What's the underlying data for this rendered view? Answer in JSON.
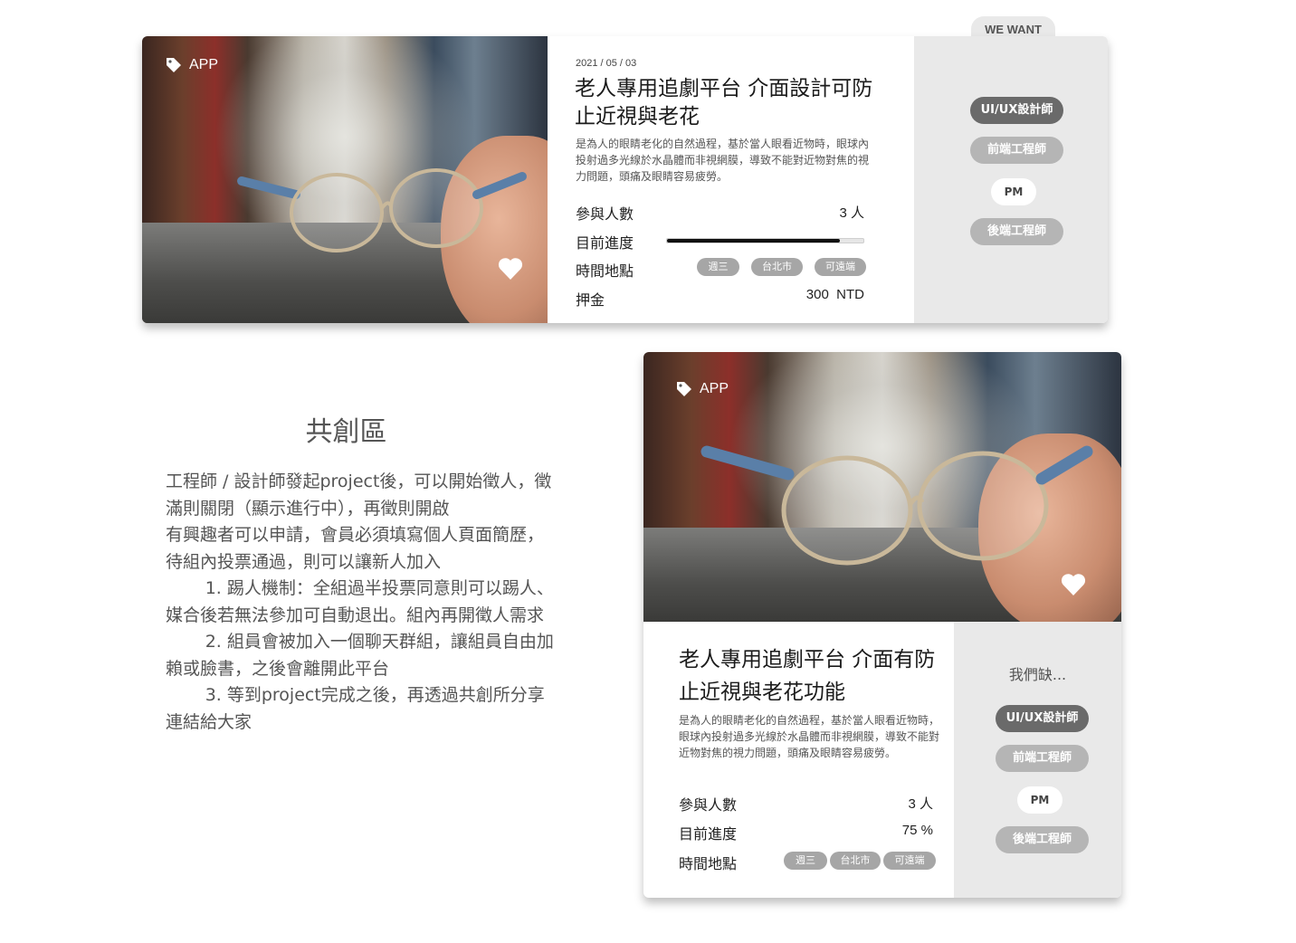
{
  "card1": {
    "tag": "APP",
    "date": "2021 / 05 / 03",
    "title": "老人專用追劇平台 介面設計可防止近視與老花",
    "desc": "是為人的眼睛老化的自然過程，基於當人眼看近物時，眼球內投射過多光線於水晶體而非視網膜，導致不能對近物對焦的視力問題，頭痛及眼睛容易疲勞。",
    "rows": {
      "participants_label": "參與人數",
      "participants_value": "3 人",
      "progress_label": "目前進度",
      "progress_fraction": 0.88,
      "time_label": "時間地點",
      "deposit_label": "押金",
      "deposit_value": "300  NTD"
    },
    "pills": [
      "週三",
      "台北市",
      "可遠端"
    ],
    "want_title": "WE WANT",
    "roles": [
      "UI/UX設計師",
      "前端工程師",
      "PM",
      "後端工程師"
    ]
  },
  "section": {
    "title": "共創區",
    "paragraphs": [
      "工程師 / 設計師發起project後，可以開始徵人，徵滿則關閉（顯示進行中），再徵則開啟",
      "有興趣者可以申請，會員必須填寫個人頁面簡歷，待組內投票通過，則可以讓新人加入",
      "1. 踢人機制：全組過半投票同意則可以踢人、媒合後若無法參加可自動退出。組內再開徵人需求",
      "2. 組員會被加入一個聊天群組，讓組員自由加賴或臉書，之後會離開此平台",
      "3. 等到project完成之後，再透過共創所分享連結給大家"
    ]
  },
  "card2": {
    "tag": "APP",
    "title": "老人專用追劇平台 介面有防止近視與老花功能",
    "desc": "是為人的眼睛老化的自然過程，基於當人眼看近物時，眼球內投射過多光線於水晶體而非視網膜，導致不能對近物對焦的視力問題，頭痛及眼睛容易疲勞。",
    "rows": {
      "participants_label": "參與人數",
      "participants_value": "3 人",
      "progress_label": "目前進度",
      "progress_value": "75 %",
      "time_label": "時間地點"
    },
    "pills": [
      "週三",
      "台北市",
      "可遠端"
    ],
    "want_title": "我們缺...",
    "roles": [
      "UI/UX設計師",
      "前端工程師",
      "PM",
      "後端工程師"
    ]
  },
  "colors": {
    "role_dark": "#6a6a6a",
    "role_mid": "#b5b5b5",
    "panel": "#e9e9e9",
    "pill": "#a6a6a6"
  }
}
